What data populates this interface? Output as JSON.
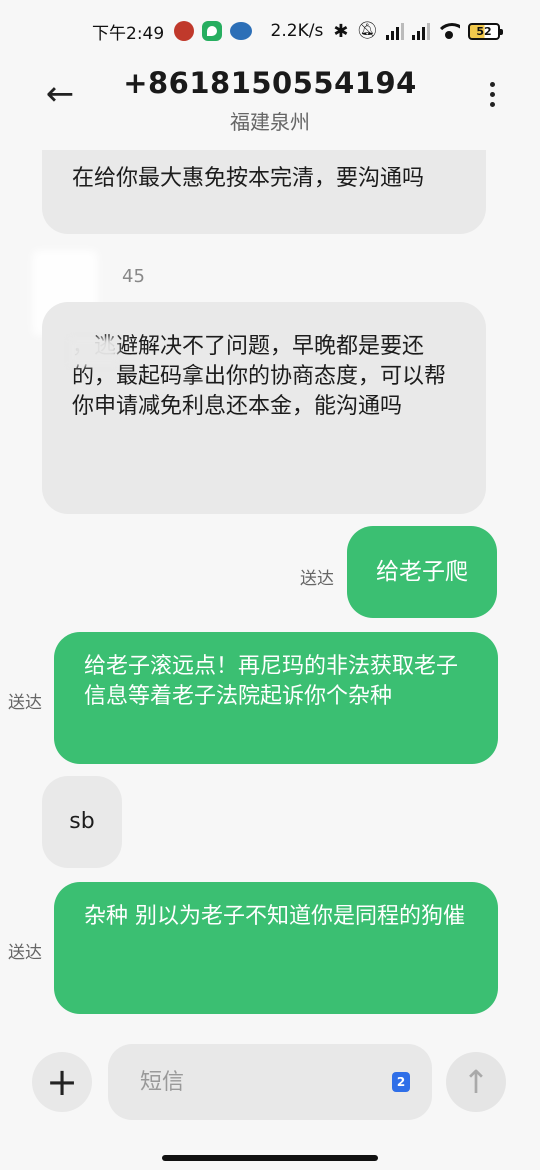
{
  "status_bar": {
    "time": "下午2:49",
    "net_speed": "2.2K/s",
    "battery": "52",
    "icons": [
      "app-icon",
      "shield-icon",
      "app-icon",
      "bluetooth-icon",
      "mute-icon",
      "signal-icon",
      "signal-icon",
      "wifi-icon",
      "battery-icon"
    ]
  },
  "header": {
    "back_icon": "←",
    "phone": "+8618150554194",
    "location": "福建泉州"
  },
  "messages": [
    {
      "type": "received",
      "text": "在给你最大惠免按本完清，要沟通吗"
    },
    {
      "type": "timestamp",
      "text": "45"
    },
    {
      "type": "received",
      "text": "，逃避解决不了问题，早晚都是要还的，最起码拿出你的协商态度，可以帮你申请减免利息还本金，能沟通吗"
    },
    {
      "type": "sent",
      "text": "给老子爬",
      "status": "送达"
    },
    {
      "type": "sent",
      "text": "给老子滚远点！再尼玛的非法获取老子信息等着老子法院起诉你个杂种",
      "status": "送达"
    },
    {
      "type": "received",
      "text": "sb"
    },
    {
      "type": "sent",
      "text": "杂种 别以为老子不知道你是同程的狗催",
      "status": "送达"
    }
  ],
  "input": {
    "placeholder": "短信",
    "sim": "2",
    "plus_icon": "+",
    "send_icon": "↑"
  }
}
